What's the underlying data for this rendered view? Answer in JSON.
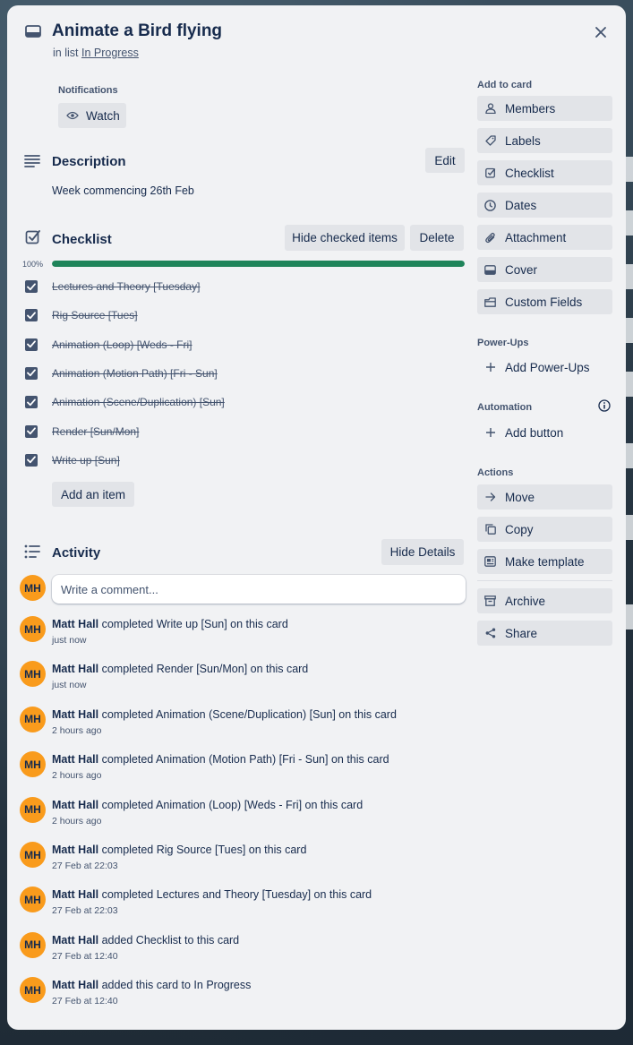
{
  "card": {
    "title": "Animate a Bird flying",
    "in_list_prefix": "in list",
    "list_name": "In Progress"
  },
  "notifications": {
    "label": "Notifications",
    "watch_label": "Watch"
  },
  "description": {
    "heading": "Description",
    "edit_label": "Edit",
    "text": "Week commencing 26th Feb"
  },
  "checklist": {
    "heading": "Checklist",
    "hide_checked_label": "Hide checked items",
    "delete_label": "Delete",
    "progress_label": "100%",
    "progress": 1.0,
    "items": [
      {
        "text": "Lectures and Theory [Tuesday]",
        "checked": true
      },
      {
        "text": "Rig Source [Tues]",
        "checked": true
      },
      {
        "text": "Animation (Loop) [Weds - Fri]",
        "checked": true
      },
      {
        "text": "Animation (Motion Path) [Fri - Sun]",
        "checked": true
      },
      {
        "text": "Animation (Scene/Duplication) [Sun]",
        "checked": true
      },
      {
        "text": "Render [Sun/Mon]",
        "checked": true
      },
      {
        "text": "Write up [Sun]",
        "checked": true
      }
    ],
    "add_item_label": "Add an item"
  },
  "activity": {
    "heading": "Activity",
    "hide_details_label": "Hide Details",
    "comment_placeholder": "Write a comment...",
    "user_initials": "MH",
    "entries": [
      {
        "user": "Matt Hall",
        "action": "completed Write up [Sun] on this card",
        "time": "just now"
      },
      {
        "user": "Matt Hall",
        "action": "completed Render [Sun/Mon] on this card",
        "time": "just now"
      },
      {
        "user": "Matt Hall",
        "action": "completed Animation (Scene/Duplication) [Sun] on this card",
        "time": "2 hours ago"
      },
      {
        "user": "Matt Hall",
        "action": "completed Animation (Motion Path) [Fri - Sun] on this card",
        "time": "2 hours ago"
      },
      {
        "user": "Matt Hall",
        "action": "completed Animation (Loop) [Weds - Fri] on this card",
        "time": "2 hours ago"
      },
      {
        "user": "Matt Hall",
        "action": "completed Rig Source [Tues] on this card",
        "time": "27 Feb at 22:03"
      },
      {
        "user": "Matt Hall",
        "action": "completed Lectures and Theory [Tuesday] on this card",
        "time": "27 Feb at 22:03"
      },
      {
        "user": "Matt Hall",
        "action": "added Checklist to this card",
        "time": "27 Feb at 12:40"
      },
      {
        "user": "Matt Hall",
        "action": "added this card to In Progress",
        "time": "27 Feb at 12:40"
      }
    ]
  },
  "sidebar": {
    "add_to_card_label": "Add to card",
    "add_to_card": [
      {
        "label": "Members",
        "icon": "person-icon"
      },
      {
        "label": "Labels",
        "icon": "tag-icon"
      },
      {
        "label": "Checklist",
        "icon": "checklist-icon"
      },
      {
        "label": "Dates",
        "icon": "clock-icon"
      },
      {
        "label": "Attachment",
        "icon": "paperclip-icon"
      },
      {
        "label": "Cover",
        "icon": "cover-icon"
      },
      {
        "label": "Custom Fields",
        "icon": "custom-fields-icon"
      }
    ],
    "powerups_label": "Power-Ups",
    "add_powerups_label": "Add Power-Ups",
    "automation_label": "Automation",
    "add_button_label": "Add button",
    "actions_label": "Actions",
    "actions": [
      {
        "label": "Move",
        "icon": "arrow-right-icon"
      },
      {
        "label": "Copy",
        "icon": "copy-icon"
      },
      {
        "label": "Make template",
        "icon": "template-icon"
      }
    ],
    "archive_label": "Archive",
    "share_label": "Share"
  },
  "colors": {
    "progress": "#1f845a",
    "avatar": "#f99b1c",
    "modal_bg": "#f1f2f4",
    "button_bg": "#e2e4e8"
  }
}
